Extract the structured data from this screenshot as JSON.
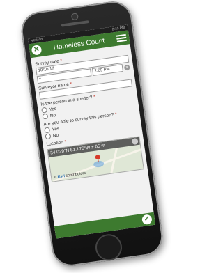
{
  "status": {
    "carrier": "Verizon",
    "time": "2:10 PM"
  },
  "app": {
    "title": "Homeless Count",
    "accent": "#3d7a2f"
  },
  "form": {
    "survey_date_label": "Survey date",
    "survey_date_value": "10/10/17",
    "survey_time_value": "2:09 PM",
    "surveyor_label": "Surveyor name",
    "surveyor_value": "",
    "shelter_label": "Is the person in a shelter?",
    "shelter_options": [
      "Yes",
      "No"
    ],
    "able_label": "Are you able to survey this person?",
    "able_options": [
      "Yes",
      "No"
    ],
    "location_label": "Location",
    "location_value": "34.029°N 81.176°W ± 65 m",
    "attribution_prefix": "© ",
    "attribution_brand": "Esri",
    "attribution_suffix": " contributors",
    "required_mark": "*"
  },
  "icons": {
    "close": "close-icon",
    "menu": "menu-icon",
    "submit": "check-icon",
    "clear": "clear-icon"
  }
}
